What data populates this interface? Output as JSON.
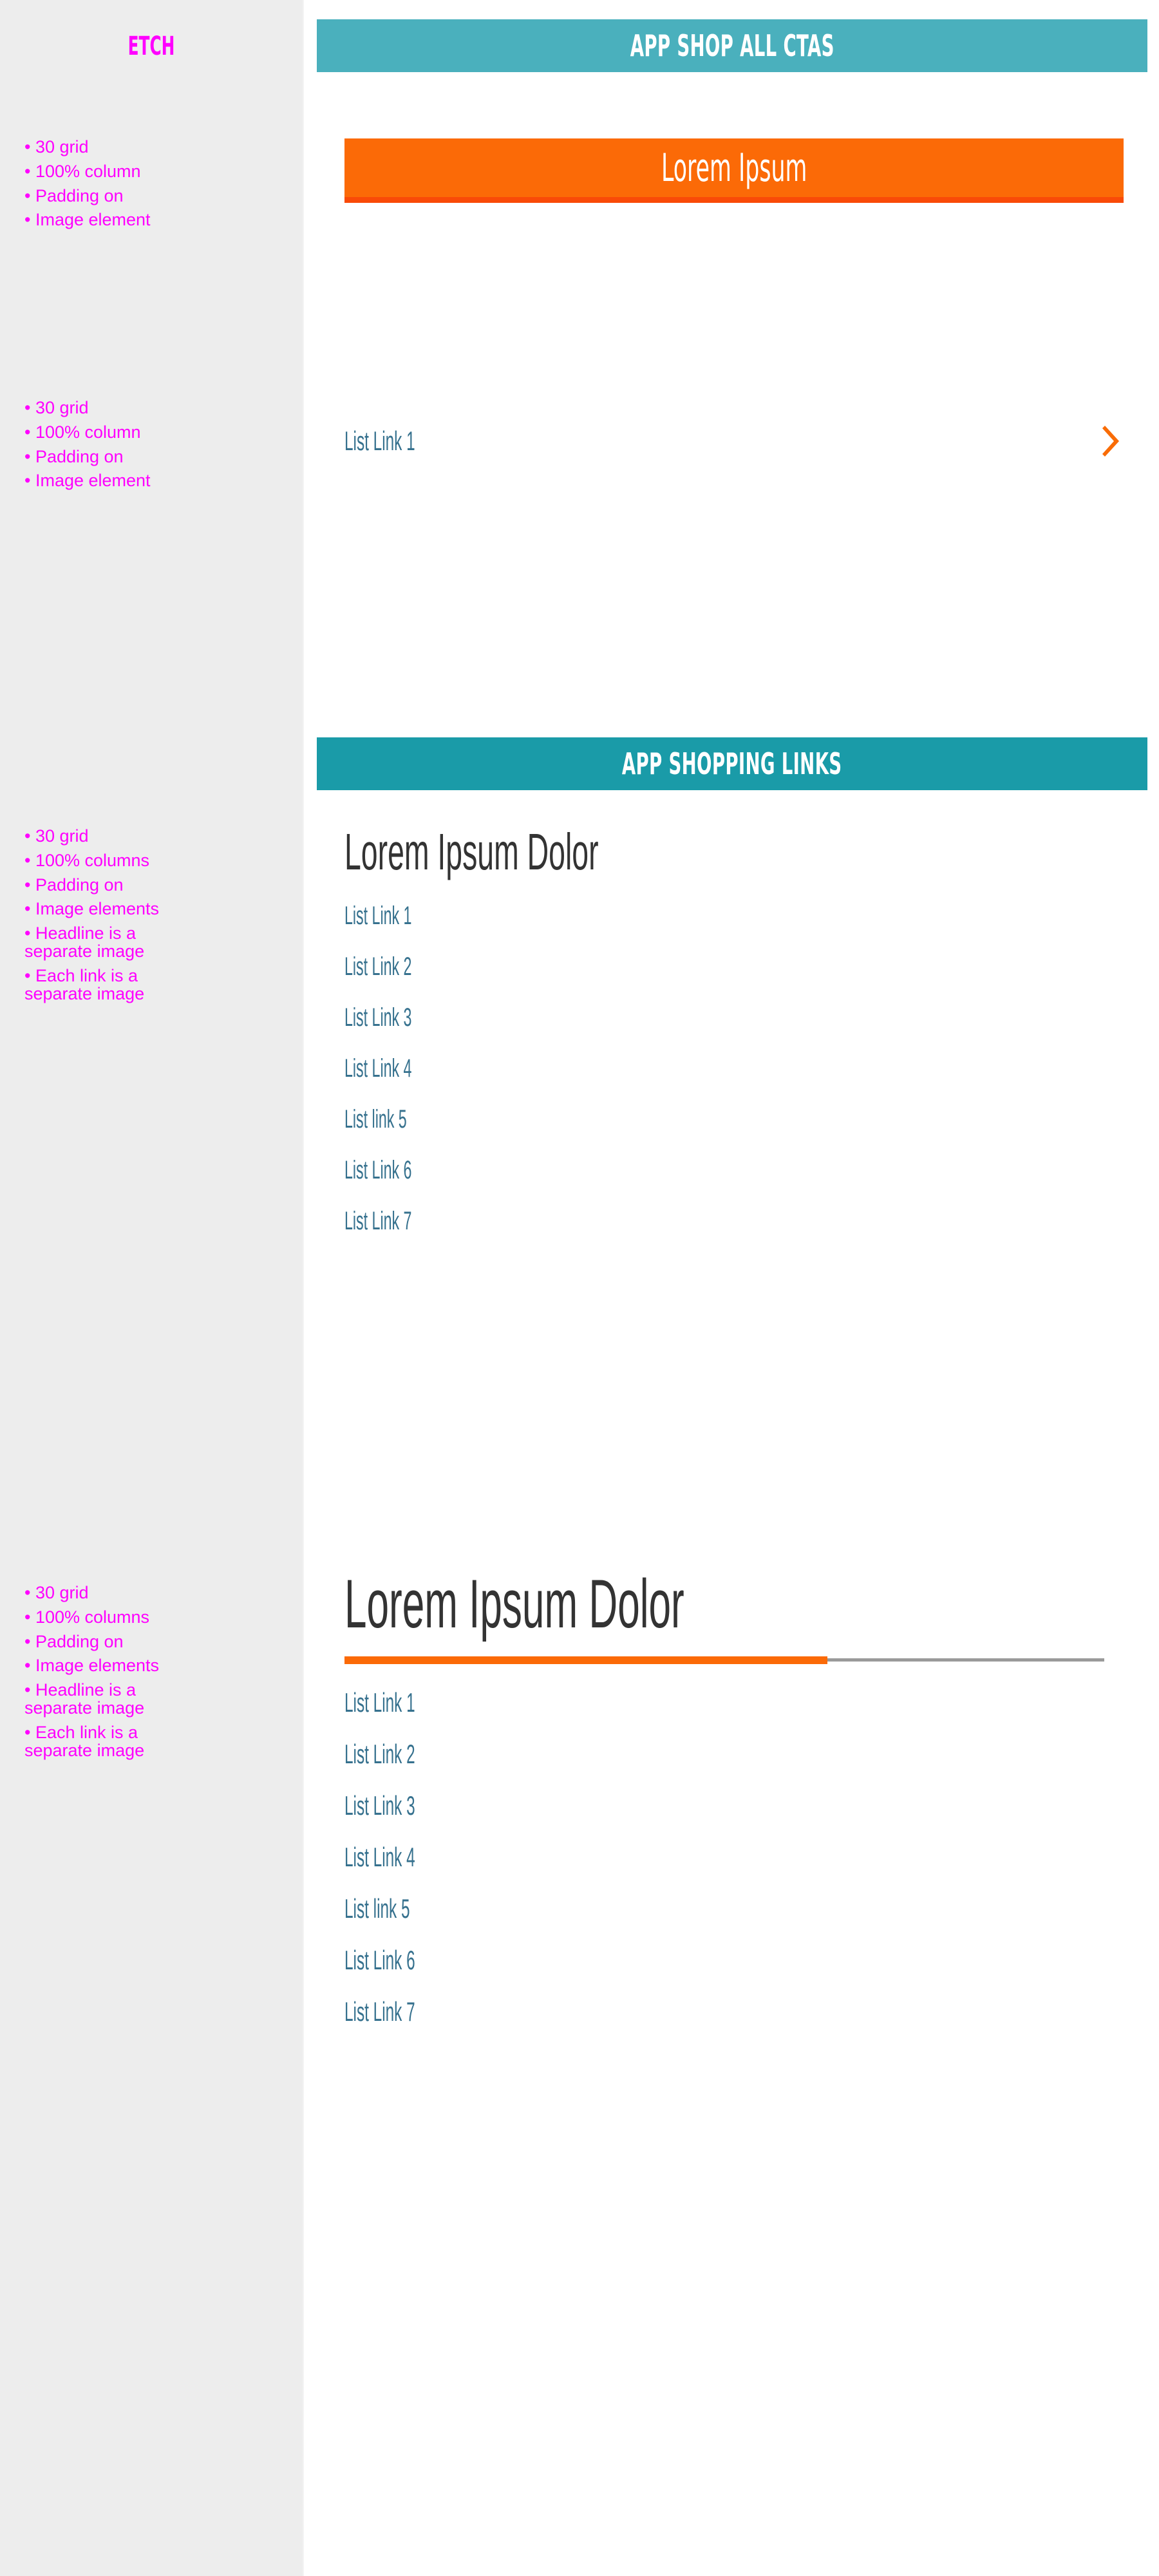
{
  "sidebar": {
    "logo": "ETCH",
    "annotation_blocks": [
      {
        "id": "block-1",
        "lines": [
          "• 30 grid",
          "• 100% column",
          "• Padding on",
          "• Image element"
        ]
      },
      {
        "id": "block-2",
        "lines": [
          "• 30 grid",
          "• 100% column",
          "• Padding on",
          "• Image element"
        ]
      },
      {
        "id": "block-3",
        "lines": [
          "• 30 grid",
          "• 100% columns",
          "• Padding on",
          "• Image elements",
          "• Headline is a\nseparate image",
          "• Each link is a\nseparate image"
        ]
      },
      {
        "id": "block-4",
        "lines": [
          "• 30 grid",
          "• 100% columns",
          "• Padding on",
          "• Image elements",
          "• Headline is a\nseparate image",
          "• Each link is a\nseparate image"
        ]
      }
    ]
  },
  "main": {
    "sections": [
      {
        "id": "app-shop-all-ctas",
        "bar_title": "APP SHOP ALL CTAS",
        "bar_color": "#4ab0bd",
        "cta_button": {
          "label": "Lorem Ipsum",
          "background": "#fb6a07",
          "accent": "#f94a08",
          "text_color": "#ffffff"
        },
        "cta_row": {
          "label": "List Link 1",
          "icon": "chevron-right-icon",
          "icon_color": "#f96c06",
          "text_color": "#36718e"
        }
      },
      {
        "id": "app-shopping-links",
        "bar_title": "APP SHOPPING LINKS",
        "bar_color": "#1a9ba8",
        "groups": [
          {
            "id": "group-small",
            "headline": "Lorem Ipsum Dolor",
            "headline_color": "#333333",
            "has_divider": false,
            "links": [
              "List Link 1",
              "List Link 2",
              "List Link 3",
              "List Link 4",
              "List link 5",
              "List Link 6",
              "List Link 7"
            ]
          },
          {
            "id": "group-large",
            "headline": "Lorem Ipsum Dolor",
            "headline_color": "#333333",
            "has_divider": true,
            "divider_orange": "#fb6a07",
            "divider_grey": "#9a9a9a",
            "links": [
              "List Link 1",
              "List Link 2",
              "List Link 3",
              "List Link 4",
              "List link 5",
              "List Link 6",
              "List Link 7"
            ]
          }
        ]
      }
    ]
  },
  "colors": {
    "sidebar_background": "#ededed",
    "annotation": "#ff00ff",
    "link": "#36718e",
    "orange": "#fb6a07",
    "teal_light": "#4ab0bd",
    "teal_dark": "#1a9ba8"
  }
}
